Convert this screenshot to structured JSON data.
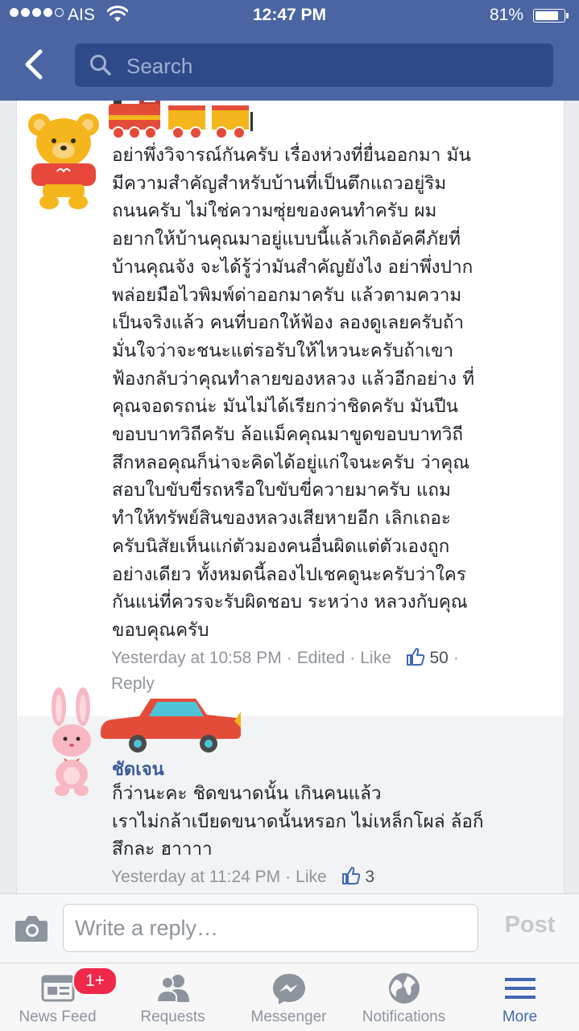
{
  "status_bar": {
    "carrier": "AIS",
    "time": "12:47 PM",
    "battery": "81%",
    "battery_level": 0.81
  },
  "header": {
    "search_placeholder": "Search"
  },
  "comments": [
    {
      "author": "",
      "text": "อย่าพึ่งวิจารณ์กันครับ เรื่องห่วงที่ยื่นออกมา มัน\nมีความสำคัญสำหรับบ้านที่เป็นตึกแถวอยู่ริม\nถนนครับ ไม่ใช่ความซุ่ยของคนทำครับ ผม\nอยากให้บ้านคุณมาอยู่แบบนี้แล้วเกิดอัคคีภัยที่\nบ้านคุณจัง จะได้รู้ว่ามันสำคัญยังไง อย่าพึ่งปาก\nพล่อยมือไวพิมพ์ด่าออกมาครับ แล้วตามความ\nเป็นจริงแล้ว คนที่บอกให้ฟ้อง ลองดูเลยครับถ้า\nมั่นใจว่าจะชนะแต่รอรับให้ไหวนะครับถ้าเขา\nฟ้องกลับว่าคุณทำลายของหลวง แล้วอีกอย่าง ที่\nคุณจอดรถน่ะ มันไม่ได้เรียกว่าชิดครับ มันปีน\nขอบบาทวิถีครับ ล้อแม็คคุณมาขูดขอบบาทวิถี\nสึกหลอคุณก็น่าจะคิดได้อยู่แก่ใจนะครับ ว่าคุณ\nสอบใบขับขี่รถหรือใบขับขี่ควายมาครับ แถม\nทำให้ทรัพย์สินของหลวงเสียหายอีก เลิกเถอะ\nครับนิสัยเห็นแก่ตัวมองคนอื่นผิดแต่ตัวเองถูก\nอย่างเดียว ทั้งหมดนี้ลองไปเชคดูนะครับว่าใคร\nกันแน่ที่ควรจะรับผิดชอบ ระหว่าง หลวงกับคุณ\nขอบคุณครับ",
      "time": "Yesterday at 10:58 PM",
      "edited": "Edited",
      "like": "Like",
      "likes": "50",
      "reply": "Reply"
    },
    {
      "author": "ชัดเจน",
      "text": "ก็ว่านะคะ ชิดขนาดนั้น เกินคนแล้ว\nเราไม่กล้าเบียดขนาดนั้นหรอก ไม่เหล็กโผล่ ล้อก็\nสึกละ ฮาาาา",
      "time": "Yesterday at 11:24 PM",
      "like": "Like",
      "likes": "3"
    }
  ],
  "composer": {
    "placeholder": "Write a reply…",
    "post": "Post"
  },
  "tabs": [
    {
      "label": "News Feed",
      "icon": "news-feed-icon",
      "badge": "1+"
    },
    {
      "label": "Requests",
      "icon": "friends-icon"
    },
    {
      "label": "Messenger",
      "icon": "messenger-icon"
    },
    {
      "label": "Notifications",
      "icon": "globe-icon"
    },
    {
      "label": "More",
      "icon": "menu-icon",
      "active": true
    }
  ],
  "colors": {
    "header": "#4a65a2",
    "search_bg": "#2e4a88",
    "link": "#365899",
    "meta": "#90949c",
    "active_tab": "#4267b2",
    "badge": "#f02849"
  }
}
